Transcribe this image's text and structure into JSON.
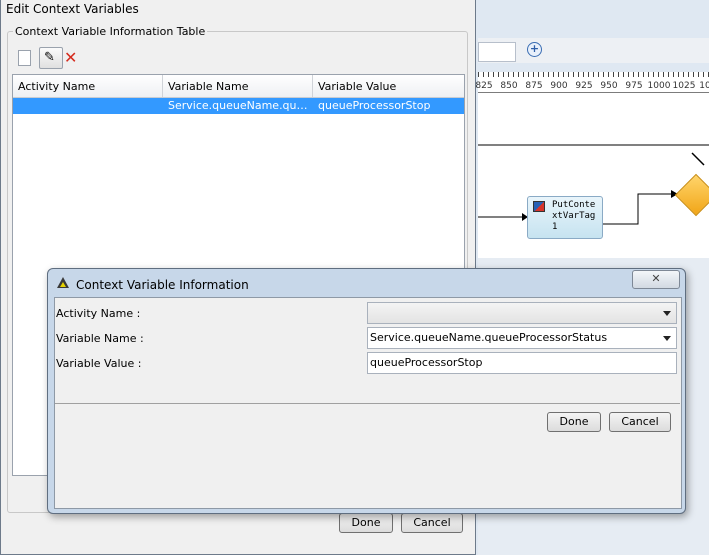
{
  "background_editor": {
    "ruler_labels": [
      "825",
      "850",
      "875",
      "900",
      "925",
      "950",
      "975",
      "1000",
      "1025",
      "10"
    ],
    "task_node_label": "PutContextVarTag1"
  },
  "edit_dialog": {
    "title": "Edit Context Variables",
    "section_title": "Context Variable Information Table",
    "columns": [
      "Activity Name",
      "Variable Name",
      "Variable Value"
    ],
    "rows": [
      {
        "activity": "",
        "variable": "Service.queueName.queueProcessorStatus",
        "value": "queueProcessorStop"
      }
    ],
    "done_label": "Done",
    "cancel_label": "Cancel"
  },
  "info_dialog": {
    "title": "Context Variable Information",
    "activity_label": "Activity Name :",
    "activity_value": "",
    "variable_label": "Variable Name :",
    "variable_value": "Service.queueName.queueProcessorStatus",
    "value_label": "Variable Value :",
    "value_value": "queueProcessorStop",
    "done_label": "Done",
    "cancel_label": "Cancel"
  },
  "colors": {
    "selection": "#3399ff",
    "dialog_frame": "#c7d7e9",
    "delete_icon": "#d52b1e"
  }
}
